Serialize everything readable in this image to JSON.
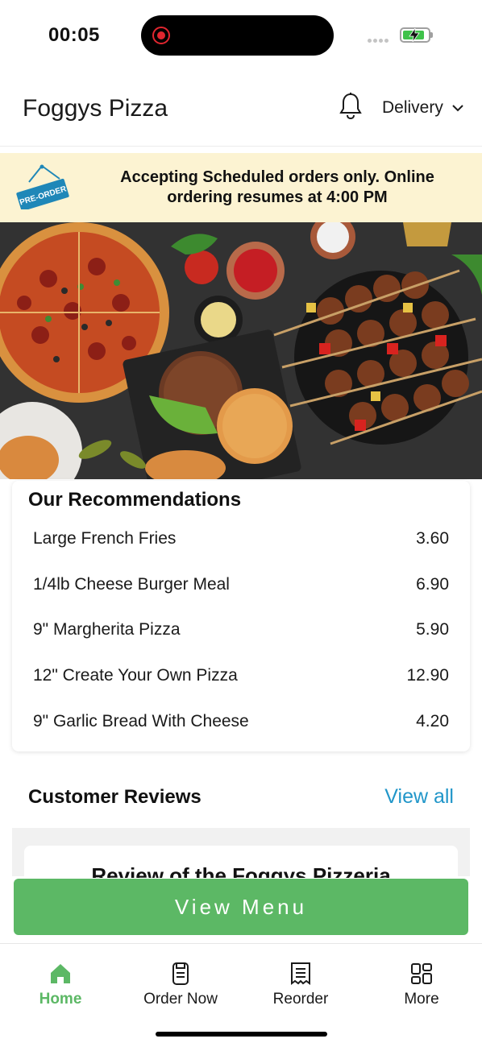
{
  "status_bar": {
    "time": "00:05"
  },
  "header": {
    "title": "Foggys Pizza",
    "order_type": "Delivery"
  },
  "banner": {
    "tag_label": "PRE-ORDER",
    "message": "Accepting Scheduled orders only. Online ordering resumes at 4:00 PM"
  },
  "recommendations": {
    "title": "Our Recommendations",
    "items": [
      {
        "name": "Large French Fries",
        "price": "3.60"
      },
      {
        "name": "1/4lb Cheese Burger Meal",
        "price": "6.90"
      },
      {
        "name": "9\" Margherita Pizza",
        "price": "5.90"
      },
      {
        "name": "12\" Create Your Own Pizza",
        "price": "12.90"
      },
      {
        "name": "9\" Garlic Bread With Cheese",
        "price": "4.20"
      }
    ]
  },
  "reviews": {
    "title": "Customer Reviews",
    "view_all": "View all",
    "first_review_title": "Review of the Foggys Pizzeria"
  },
  "cta": {
    "label": "View Menu"
  },
  "bottom_nav": {
    "items": [
      {
        "label": "Home",
        "icon": "home-icon",
        "active": true
      },
      {
        "label": "Order Now",
        "icon": "phone-order-icon",
        "active": false
      },
      {
        "label": "Reorder",
        "icon": "receipt-icon",
        "active": false
      },
      {
        "label": "More",
        "icon": "grid-icon",
        "active": false
      }
    ]
  },
  "colors": {
    "brand_green": "#5cb865",
    "link_blue": "#2196c9",
    "banner_bg": "#fcf3d2",
    "tag_blue": "#1f87b8"
  }
}
